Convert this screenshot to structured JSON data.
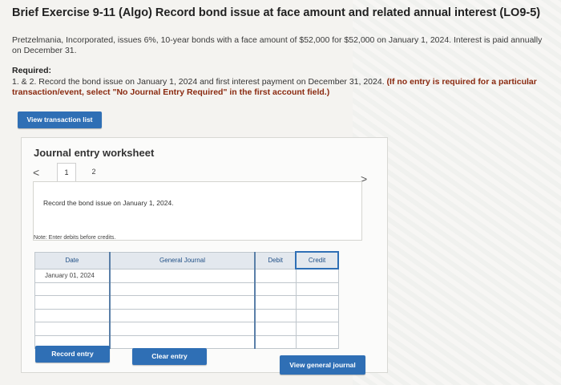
{
  "header": {
    "title": "Brief Exercise 9-11 (Algo) Record bond issue at face amount and related annual interest (LO9-5)"
  },
  "problem": {
    "intro": "Pretzelmania, Incorporated, issues 6%, 10-year bonds with a face amount of $52,000 for $52,000 on January 1, 2024. Interest is paid annually on December 31.",
    "required_label": "Required:",
    "required_text": "1. & 2. Record the bond issue on January 1, 2024 and first interest payment on December 31, 2024.",
    "required_note": "(If no entry is required for a particular transaction/event, select \"No Journal Entry Required\" in the first account field.)"
  },
  "buttons": {
    "view_transaction_list": "View transaction list",
    "record_entry": "Record entry",
    "clear_entry": "Clear entry",
    "view_general_journal": "View general journal"
  },
  "worksheet": {
    "title": "Journal entry worksheet",
    "nav_prev": "<",
    "nav_next": ">",
    "tabs": [
      "1",
      "2"
    ],
    "description": "Record the bond issue on January 1, 2024.",
    "note": "Note: Enter debits before credits."
  },
  "journal_table": {
    "headers": {
      "date": "Date",
      "general_journal": "General Journal",
      "debit": "Debit",
      "credit": "Credit"
    },
    "rows": [
      {
        "date": "January 01, 2024",
        "account": "",
        "debit": "",
        "credit": ""
      },
      {
        "date": "",
        "account": "",
        "debit": "",
        "credit": ""
      },
      {
        "date": "",
        "account": "",
        "debit": "",
        "credit": ""
      },
      {
        "date": "",
        "account": "",
        "debit": "",
        "credit": ""
      },
      {
        "date": "",
        "account": "",
        "debit": "",
        "credit": ""
      },
      {
        "date": "",
        "account": "",
        "debit": "",
        "credit": ""
      }
    ]
  },
  "colors": {
    "accent": "#2f6fb5",
    "header_bg": "#e3e8ee"
  }
}
